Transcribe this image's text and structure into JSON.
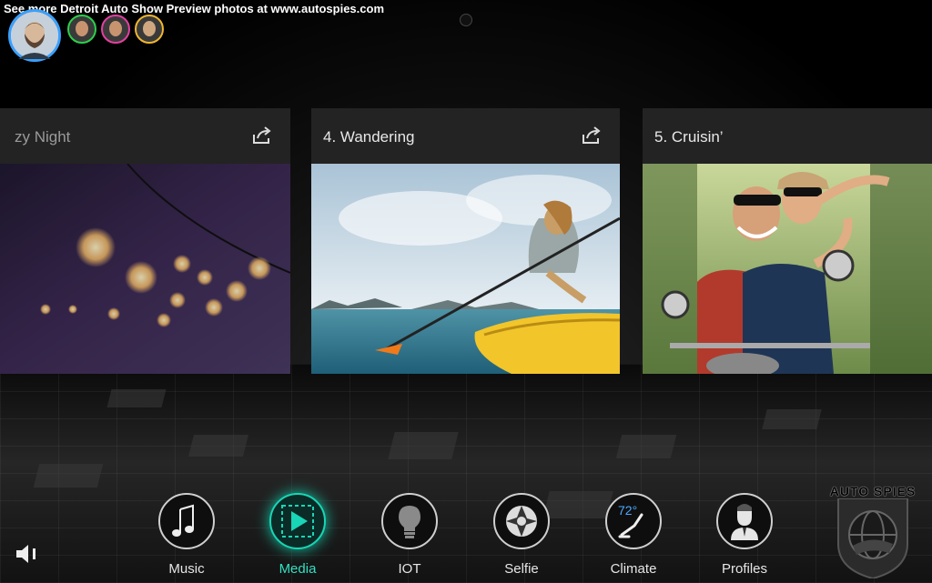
{
  "watermark": {
    "text": "See more Detroit Auto Show Preview photos at www.autospies.com"
  },
  "profiles": {
    "active_avatar": "avatar-man-beard",
    "avatars": [
      {
        "name": "avatar-man-beard",
        "ring": "#3aa0ff"
      },
      {
        "name": "avatar-green",
        "ring": "#2bd04b"
      },
      {
        "name": "avatar-pink",
        "ring": "#e43fa0"
      },
      {
        "name": "avatar-yellow",
        "ring": "#f0b72d"
      }
    ]
  },
  "cards": [
    {
      "title": "zy Night",
      "image": "night-lights-photo"
    },
    {
      "title": "4. Wandering",
      "image": "kayak-photo"
    },
    {
      "title": "5. Cruisin’",
      "image": "scooter-couple-photo"
    }
  ],
  "nav": {
    "items": [
      {
        "label": "Music",
        "icon": "music-icon"
      },
      {
        "label": "Media",
        "icon": "play-icon",
        "active": true
      },
      {
        "label": "IOT",
        "icon": "lightbulb-icon"
      },
      {
        "label": "Selfie",
        "icon": "camera-aperture-icon"
      },
      {
        "label": "Climate",
        "icon": "climate-icon",
        "temperature": "72°"
      },
      {
        "label": "Profiles",
        "icon": "profile-icon"
      }
    ]
  },
  "brand_watermark": {
    "text": "AUTO SPIES"
  },
  "colors": {
    "accent": "#18d6b6",
    "profile_ring": "#3aa0ff",
    "card_header": "#232323"
  }
}
